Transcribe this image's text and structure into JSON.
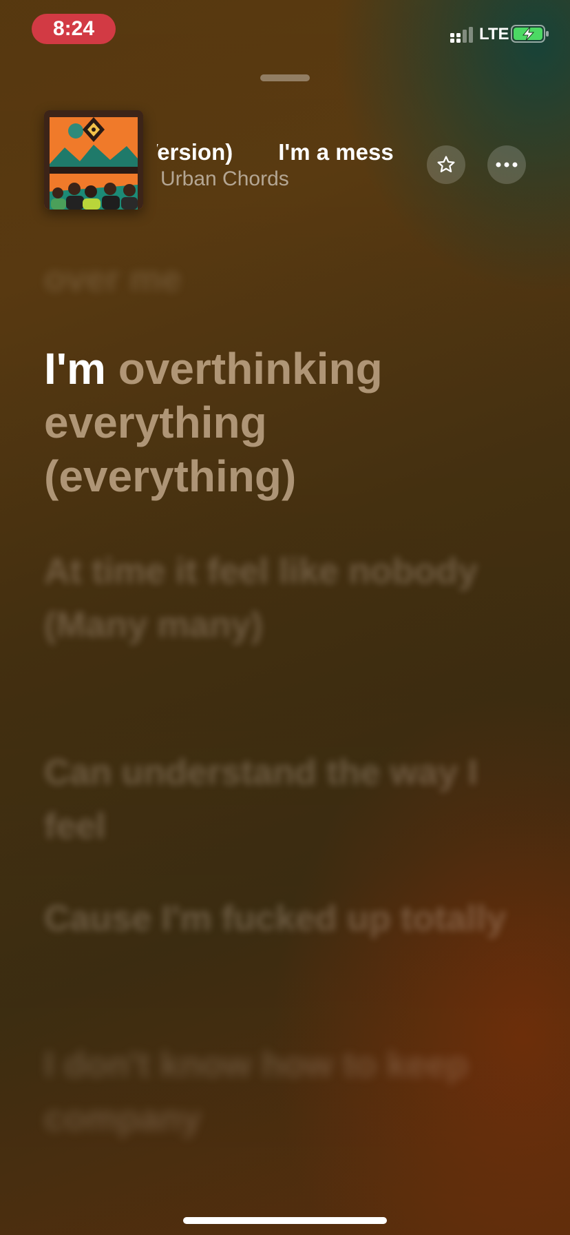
{
  "status_bar": {
    "time": "8:24",
    "carrier": "LTE",
    "battery_state": "charging",
    "accent_color": "#d23a44"
  },
  "now_playing": {
    "title_marquee": [
      "r Version)",
      "I'm a mess"
    ],
    "artist": "Urban Chords",
    "artwork_icon": "album-art-image"
  },
  "controls": {
    "favorite_icon": "star-icon",
    "more_icon": "ellipsis-icon"
  },
  "lyrics": {
    "previous_line": "over me",
    "current_line": {
      "sung": "I'm ",
      "unsung": "overthinking everything (everything)"
    },
    "upcoming_lines": [
      "At time it feel like nobody (Many many)",
      "Can understand the way I feel",
      "Cause I'm fucked up totally",
      "I don't know how to keep company"
    ]
  }
}
